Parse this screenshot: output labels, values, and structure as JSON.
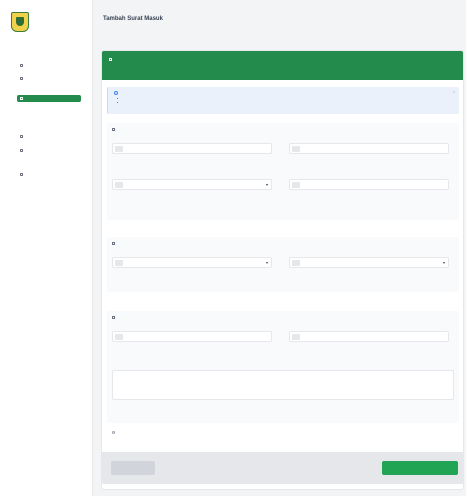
{
  "sidebar": {
    "org_name_1": "",
    "org_name_2": "",
    "menu_head": "",
    "items": [
      {
        "label": ""
      },
      {
        "label": ""
      },
      {
        "label": ""
      },
      {
        "label": ""
      },
      {
        "label": ""
      },
      {
        "label": ""
      },
      {
        "label": ""
      }
    ],
    "subitems": [
      {
        "label": ""
      },
      {
        "label": ""
      }
    ]
  },
  "header": {
    "title": "Tambah Surat Masuk",
    "subtitle": "",
    "breadcrumb": ""
  },
  "card": {
    "title": "",
    "subtitle": ""
  },
  "alert": {
    "title": "",
    "items": [
      "",
      ""
    ]
  },
  "sections": {
    "s1": {
      "title": ""
    },
    "s2": {
      "title": ""
    },
    "s3": {
      "title": ""
    }
  },
  "fields": {
    "nomor_surat": {
      "label": "",
      "placeholder": "",
      "help": ""
    },
    "tanggal_surat": {
      "label": "",
      "value": "",
      "help": ""
    },
    "pengirim": {
      "label": "",
      "value": "",
      "help": ""
    },
    "tanggal_terima": {
      "label": "",
      "placeholder": "",
      "help": ""
    },
    "disposisi": {
      "label": "",
      "value": "",
      "help": ""
    },
    "prioritas": {
      "label": "",
      "value": "",
      "help": ""
    },
    "jumlah_lampiran": {
      "label": "",
      "placeholder": "",
      "help": ""
    },
    "lampiran": {
      "label": "",
      "placeholder": "",
      "help": ""
    },
    "keterangan": {
      "label": "",
      "placeholder": "",
      "help": ""
    }
  },
  "note": "",
  "footer": {
    "back_label": "",
    "save_label": ""
  },
  "colors": {
    "brand_green": "#238b4c",
    "save_green": "#22a455",
    "alert_bg": "#eaf1fb"
  }
}
